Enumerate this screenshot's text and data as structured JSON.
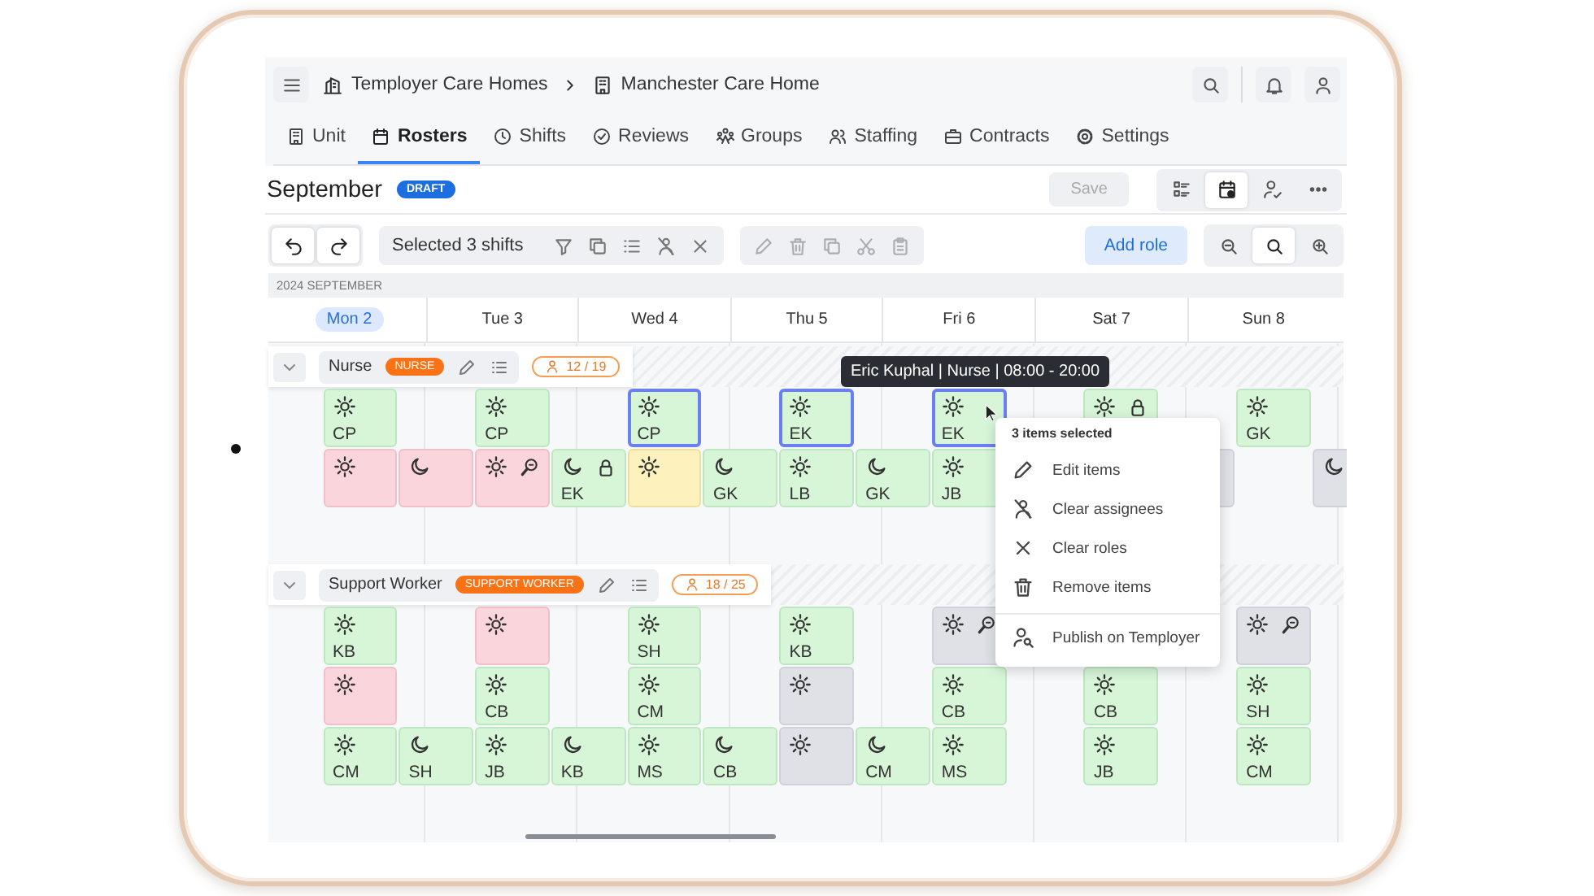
{
  "breadcrumb": [
    "Temployer Care Homes",
    "Manchester Care Home"
  ],
  "tabs": [
    {
      "label": "Unit",
      "selected": false
    },
    {
      "label": "Rosters",
      "selected": true
    },
    {
      "label": "Shifts",
      "selected": false
    },
    {
      "label": "Reviews",
      "selected": false
    },
    {
      "label": "Groups",
      "selected": false
    },
    {
      "label": "Staffing",
      "selected": false
    },
    {
      "label": "Contracts",
      "selected": false
    },
    {
      "label": "Settings",
      "selected": false
    }
  ],
  "page": {
    "title": "September",
    "status": "DRAFT",
    "save": {
      "label": "Save",
      "disabled": true
    }
  },
  "view_buttons": [
    {
      "selected": false
    },
    {
      "selected": true
    },
    {
      "selected": false
    },
    {
      "selected": false
    }
  ],
  "toolbar": {
    "selection": "Selected 3 shifts",
    "add_role": "Add role",
    "zoom_buttons": [
      {
        "selected": false
      },
      {
        "selected": true
      },
      {
        "selected": false
      }
    ]
  },
  "month_label": "2024 SEPTEMBER",
  "days": [
    {
      "label": "Mon 2",
      "selected": true
    },
    {
      "label": "Tue 3",
      "selected": false
    },
    {
      "label": "Wed 4",
      "selected": false
    },
    {
      "label": "Thu 5",
      "selected": false
    },
    {
      "label": "Fri 6",
      "selected": false
    },
    {
      "label": "Sat 7",
      "selected": false
    },
    {
      "label": "Sun 8",
      "selected": false
    }
  ],
  "tooltip": "Eric Kuphal | Nurse | 08:00 - 20:00",
  "groups": [
    {
      "name": "Nurse",
      "badge": "NURSE",
      "count": "12 / 19",
      "rows": [
        [
          {
            "kind": "filled",
            "night": false,
            "locked": false,
            "search": false,
            "selected": false,
            "initials": "CP"
          },
          {
            "kind": "empty"
          },
          {
            "kind": "filled",
            "night": false,
            "locked": false,
            "search": false,
            "selected": false,
            "initials": "CP"
          },
          {
            "kind": "empty"
          },
          {
            "kind": "filled",
            "night": false,
            "locked": false,
            "search": false,
            "selected": true,
            "initials": "CP"
          },
          {
            "kind": "empty"
          },
          {
            "kind": "filled",
            "night": false,
            "locked": false,
            "search": false,
            "selected": true,
            "initials": "EK"
          },
          {
            "kind": "empty"
          },
          {
            "kind": "filled",
            "night": false,
            "locked": false,
            "search": false,
            "selected": true,
            "pointer": true,
            "initials": "EK"
          },
          {
            "kind": "empty"
          },
          {
            "kind": "filled",
            "night": false,
            "locked": true,
            "search": false,
            "selected": false
          },
          {
            "kind": "empty"
          },
          {
            "kind": "filled",
            "night": false,
            "locked": false,
            "search": false,
            "selected": false,
            "initials": "GK"
          },
          {
            "kind": "empty"
          }
        ],
        [
          {
            "kind": "vacant",
            "night": false,
            "locked": false,
            "search": false,
            "selected": false
          },
          {
            "kind": "vacant",
            "night": true,
            "locked": false,
            "search": false,
            "selected": false
          },
          {
            "kind": "vacant",
            "night": false,
            "locked": false,
            "search": true,
            "selected": false
          },
          {
            "kind": "filled",
            "night": true,
            "locked": true,
            "search": false,
            "selected": false,
            "initials": "EK"
          },
          {
            "kind": "pending",
            "night": false,
            "locked": false,
            "search": false,
            "selected": false
          },
          {
            "kind": "filled",
            "night": true,
            "locked": false,
            "search": false,
            "selected": false,
            "initials": "GK"
          },
          {
            "kind": "filled",
            "night": false,
            "locked": false,
            "search": false,
            "selected": false,
            "initials": "LB"
          },
          {
            "kind": "filled",
            "night": true,
            "locked": false,
            "search": false,
            "selected": false,
            "initials": "GK"
          },
          {
            "kind": "filled",
            "night": false,
            "locked": false,
            "search": false,
            "selected": false,
            "initials": "JB"
          },
          {
            "kind": "empty"
          },
          {
            "kind": "empty"
          },
          {
            "kind": "covered"
          },
          {
            "kind": "empty"
          },
          {
            "kind": "open",
            "night": true,
            "locked": false,
            "search": false,
            "selected": false
          }
        ]
      ]
    },
    {
      "name": "Support Worker",
      "badge": "SUPPORT WORKER",
      "count": "18 / 25",
      "rows": [
        [
          {
            "kind": "filled",
            "night": false,
            "locked": false,
            "search": false,
            "selected": false,
            "initials": "KB"
          },
          {
            "kind": "empty"
          },
          {
            "kind": "vacant",
            "night": false,
            "locked": false,
            "search": false,
            "selected": false
          },
          {
            "kind": "empty"
          },
          {
            "kind": "filled",
            "night": false,
            "locked": false,
            "search": false,
            "selected": false,
            "initials": "SH"
          },
          {
            "kind": "empty"
          },
          {
            "kind": "filled",
            "night": false,
            "locked": false,
            "search": false,
            "selected": false,
            "initials": "KB"
          },
          {
            "kind": "empty"
          },
          {
            "kind": "open",
            "night": false,
            "locked": false,
            "search": true,
            "selected": false
          },
          {
            "kind": "empty"
          },
          {
            "kind": "empty"
          },
          {
            "kind": "empty"
          },
          {
            "kind": "open",
            "night": false,
            "locked": false,
            "search": true,
            "selected": false
          },
          {
            "kind": "empty"
          }
        ],
        [
          {
            "kind": "vacant",
            "night": false,
            "locked": false,
            "search": false,
            "selected": false
          },
          {
            "kind": "empty"
          },
          {
            "kind": "filled",
            "night": false,
            "locked": false,
            "search": false,
            "selected": false,
            "initials": "CB"
          },
          {
            "kind": "empty"
          },
          {
            "kind": "filled",
            "night": false,
            "locked": false,
            "search": false,
            "selected": false,
            "initials": "CM"
          },
          {
            "kind": "empty"
          },
          {
            "kind": "open",
            "night": false,
            "locked": false,
            "search": false,
            "selected": false
          },
          {
            "kind": "empty"
          },
          {
            "kind": "filled",
            "night": false,
            "locked": false,
            "search": false,
            "selected": false,
            "initials": "CB"
          },
          {
            "kind": "empty"
          },
          {
            "kind": "filled",
            "night": false,
            "locked": false,
            "search": false,
            "selected": false,
            "initials": "CB"
          },
          {
            "kind": "empty"
          },
          {
            "kind": "filled",
            "night": false,
            "locked": false,
            "search": false,
            "selected": false,
            "initials": "SH"
          },
          {
            "kind": "empty"
          }
        ],
        [
          {
            "kind": "filled",
            "night": false,
            "locked": false,
            "search": false,
            "selected": false,
            "initials": "CM"
          },
          {
            "kind": "filled",
            "night": true,
            "locked": false,
            "search": false,
            "selected": false,
            "initials": "SH"
          },
          {
            "kind": "filled",
            "night": false,
            "locked": false,
            "search": false,
            "selected": false,
            "initials": "JB"
          },
          {
            "kind": "filled",
            "night": true,
            "locked": false,
            "search": false,
            "selected": false,
            "initials": "KB"
          },
          {
            "kind": "filled",
            "night": false,
            "locked": false,
            "search": false,
            "selected": false,
            "initials": "MS"
          },
          {
            "kind": "filled",
            "night": true,
            "locked": false,
            "search": false,
            "selected": false,
            "initials": "CB"
          },
          {
            "kind": "open",
            "night": false,
            "locked": false,
            "search": false,
            "selected": false
          },
          {
            "kind": "filled",
            "night": true,
            "locked": false,
            "search": false,
            "selected": false,
            "initials": "CM"
          },
          {
            "kind": "filled",
            "night": false,
            "locked": false,
            "search": false,
            "selected": false,
            "initials": "MS"
          },
          {
            "kind": "empty"
          },
          {
            "kind": "filled",
            "night": false,
            "locked": false,
            "search": false,
            "selected": false,
            "initials": "JB"
          },
          {
            "kind": "empty"
          },
          {
            "kind": "filled",
            "night": false,
            "locked": false,
            "search": false,
            "selected": false,
            "initials": "CM"
          },
          {
            "kind": "empty"
          }
        ]
      ]
    }
  ],
  "context_menu": {
    "title": "3 items selected",
    "items": [
      "Edit items",
      "Clear assignees",
      "Clear roles",
      "Remove items",
      "Publish on Temployer"
    ]
  }
}
